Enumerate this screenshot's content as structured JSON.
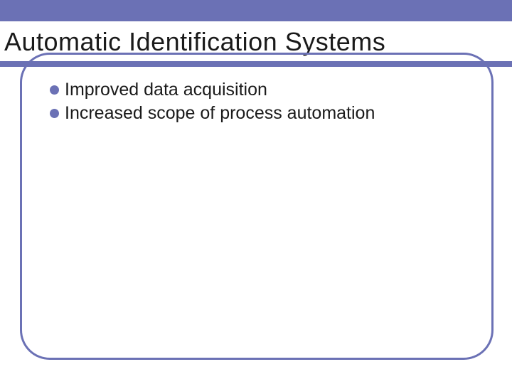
{
  "title": "Automatic Identification Systems",
  "bullets": [
    {
      "text": "Improved data acquisition"
    },
    {
      "text": "Increased scope of process automation"
    }
  ],
  "colors": {
    "accent": "#6b71b5",
    "text": "#1a1a1a",
    "background": "#ffffff"
  }
}
